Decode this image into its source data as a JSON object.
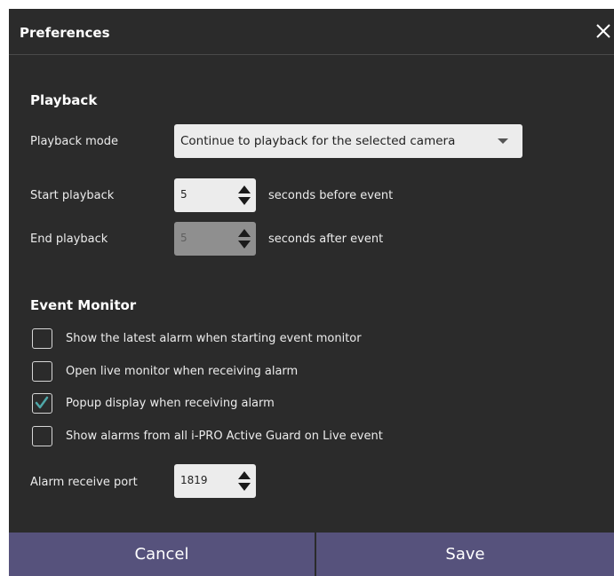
{
  "dialog": {
    "title": "Preferences"
  },
  "playback": {
    "heading": "Playback",
    "mode_label": "Playback mode",
    "mode_value": "Continue to playback for the selected camera",
    "start_label": "Start playback",
    "start_value": "5",
    "start_suffix": "seconds before event",
    "end_label": "End playback",
    "end_value": "5",
    "end_suffix": "seconds after event"
  },
  "event_monitor": {
    "heading": "Event Monitor",
    "options": [
      {
        "label": "Show the latest alarm when starting event monitor",
        "checked": false
      },
      {
        "label": "Open live monitor when receiving alarm",
        "checked": false
      },
      {
        "label": "Popup display when receiving alarm",
        "checked": true
      },
      {
        "label": "Show alarms from all i-PRO Active Guard on Live event",
        "checked": false
      }
    ],
    "port_label": "Alarm receive port",
    "port_value": "1819"
  },
  "buttons": {
    "cancel": "Cancel",
    "save": "Save"
  },
  "colors": {
    "background": "#2b2b2b",
    "button": "#56527c",
    "check_accent": "#4fa7a8"
  }
}
